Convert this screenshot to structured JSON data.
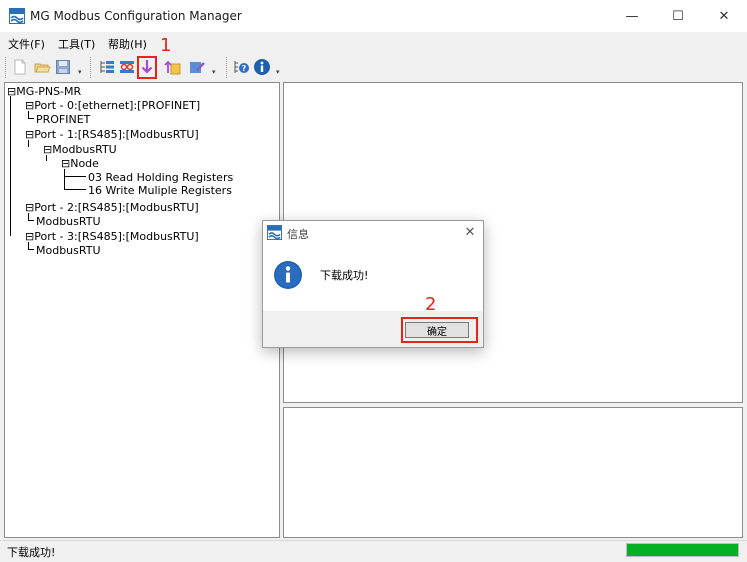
{
  "window": {
    "title": "MG Modbus Configuration Manager",
    "minimize_glyph": "—",
    "maximize_glyph": "☐",
    "close_glyph": "✕"
  },
  "menu": {
    "items": [
      {
        "label": "文件(F)"
      },
      {
        "label": "工具(T)"
      },
      {
        "label": "帮助(H)"
      }
    ]
  },
  "toolbar": {
    "buttons": [
      {
        "icon": "new-file-icon"
      },
      {
        "icon": "open-folder-icon"
      },
      {
        "icon": "save-icon"
      },
      {
        "icon": "expand-tree-icon"
      },
      {
        "icon": "connect-icon"
      },
      {
        "icon": "download-icon"
      },
      {
        "icon": "upload-icon"
      },
      {
        "icon": "edit-icon"
      },
      {
        "icon": "help-icon"
      },
      {
        "icon": "info-icon"
      }
    ],
    "dropdown_glyph": "▾"
  },
  "annotations": {
    "step1": "1",
    "step2": "2",
    "color": "#e8231b"
  },
  "tree": {
    "root": "MG-PNS-MR",
    "nodes": [
      {
        "label": "Port - 0:[ethernet]:[PROFINET]"
      },
      {
        "label": "PROFINET"
      },
      {
        "label": "Port - 1:[RS485]:[ModbusRTU]"
      },
      {
        "label": "ModbusRTU"
      },
      {
        "label": "Node"
      },
      {
        "label": "03 Read Holding Registers"
      },
      {
        "label": "16 Write Muliple Registers"
      },
      {
        "label": "Port - 2:[RS485]:[ModbusRTU]"
      },
      {
        "label": "ModbusRTU"
      },
      {
        "label": "Port - 3:[RS485]:[ModbusRTU]"
      },
      {
        "label": "ModbusRTU"
      }
    ]
  },
  "dialog": {
    "title": "信息",
    "close_glyph": "✕",
    "message": "下载成功!",
    "ok_label": "确定"
  },
  "status": {
    "text": "下载成功!",
    "progress": 1.0,
    "progress_color": "#06b025"
  }
}
